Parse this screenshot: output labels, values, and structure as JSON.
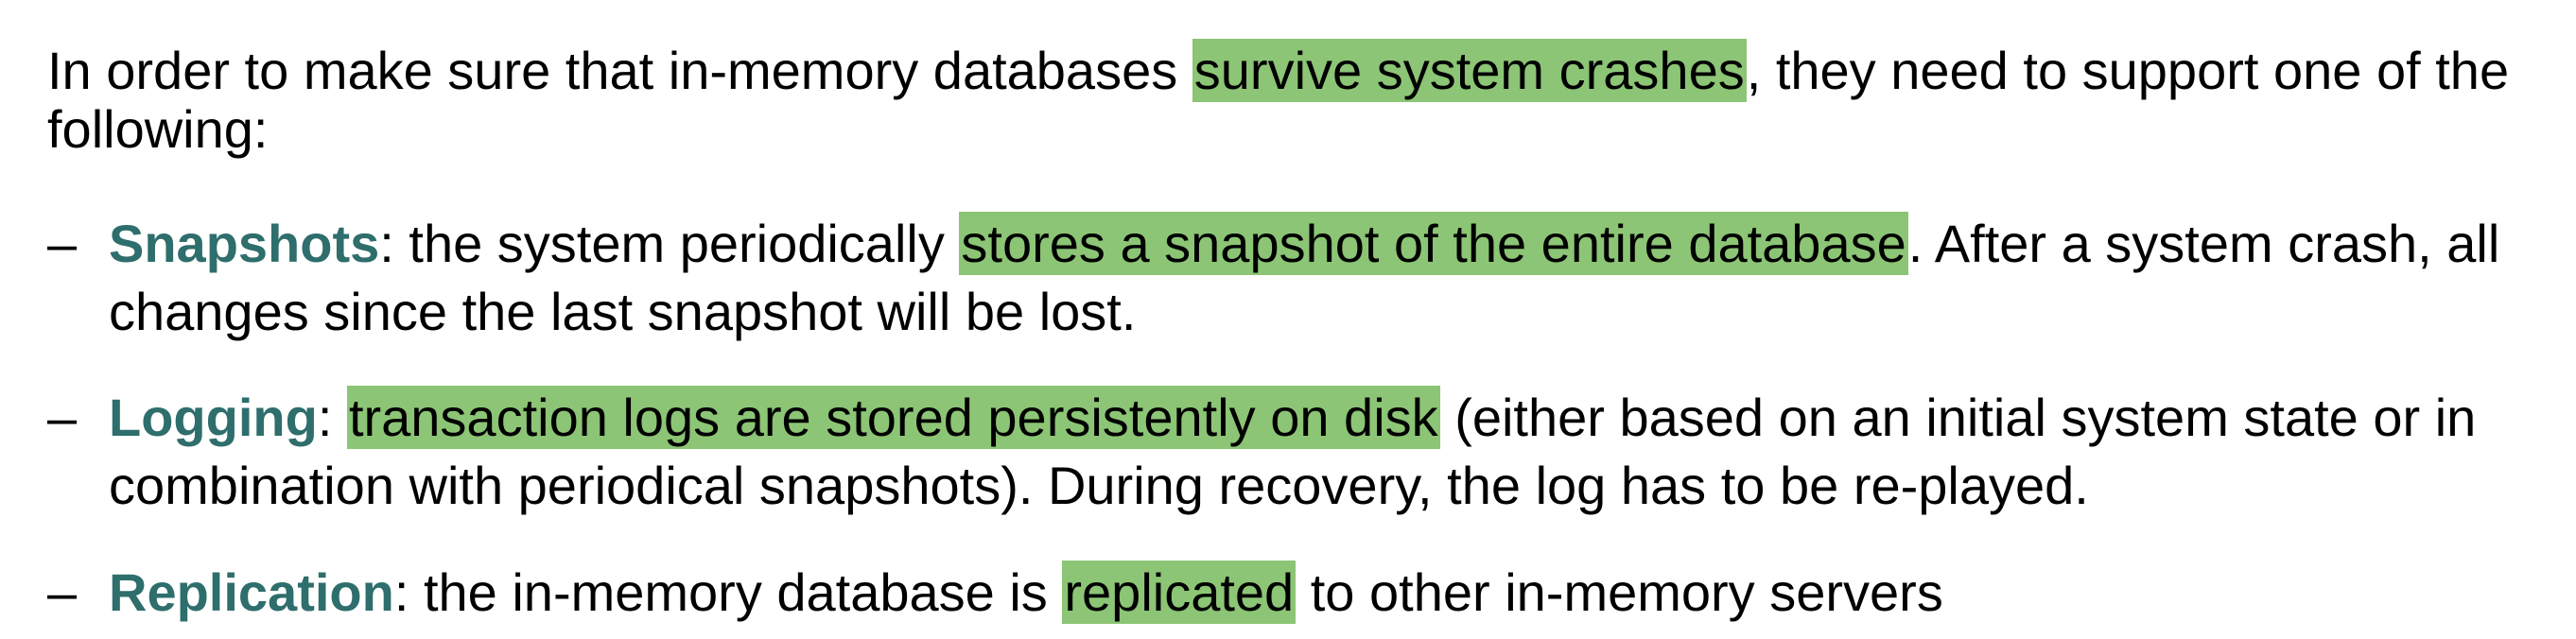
{
  "intro": {
    "before": "In order to make sure that in-memory databases ",
    "highlight": "survive system crashes",
    "after": ", they need to support one of the following:"
  },
  "bullets": [
    {
      "dash": "–",
      "term": "Snapshots",
      "before": ": the system periodically ",
      "highlight": "stores a snapshot of the entire database",
      "after": ". After a system crash, all changes since the last snapshot will be lost."
    },
    {
      "dash": "–",
      "term": "Logging",
      "before": ": ",
      "highlight": "transaction logs are stored persistently on disk",
      "after": " (either based on an initial system state or in combination with periodical snapshots). During recovery, the log has to be re-played."
    },
    {
      "dash": "–",
      "term": "Replication",
      "before": ": the in-memory database is ",
      "highlight": "replicated",
      "after": " to other in-memory servers"
    }
  ],
  "colors": {
    "term": "#2e6e6c",
    "highlight": "#8cc575",
    "text": "#000000"
  }
}
